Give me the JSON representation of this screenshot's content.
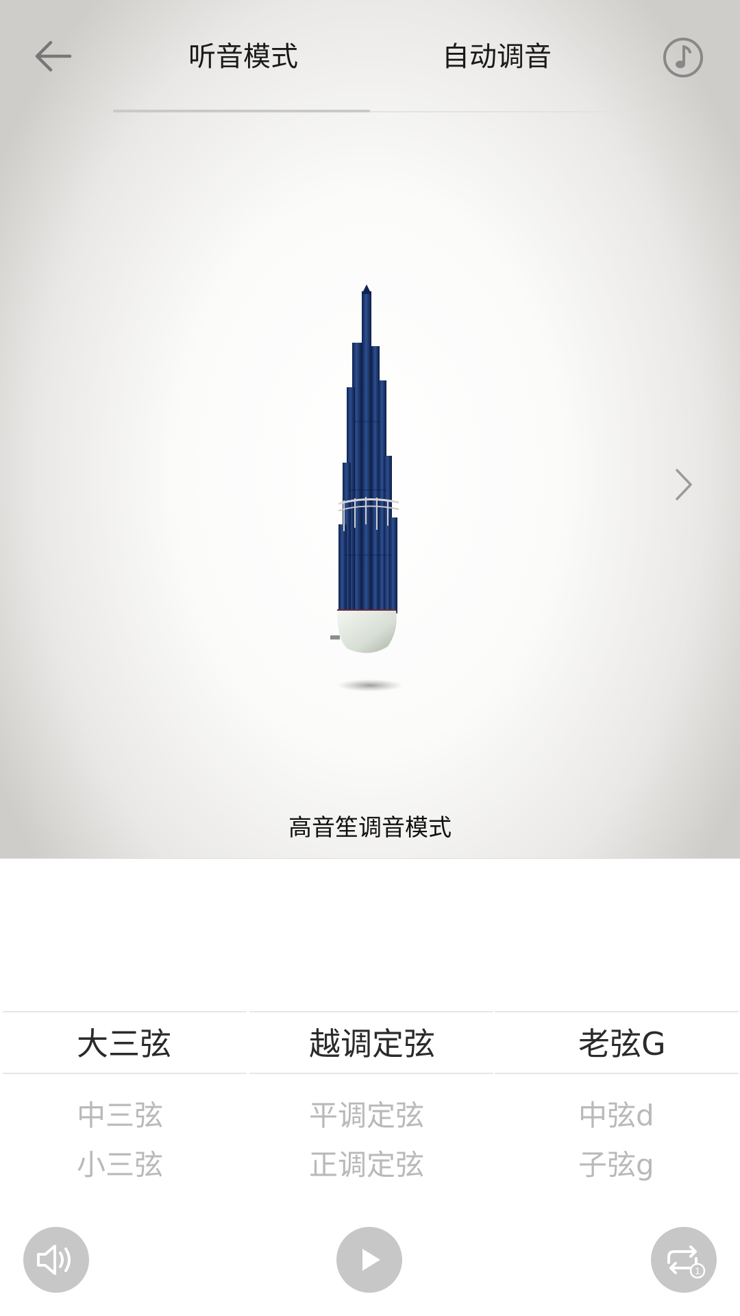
{
  "header": {
    "back_icon": "arrow-left-icon",
    "tabs": [
      {
        "label": "听音模式",
        "active": true
      },
      {
        "label": "自动调音",
        "active": false
      }
    ],
    "settings_icon": "music-note-circle-icon"
  },
  "main": {
    "instrument_icon": "sheng-instrument-image",
    "next_icon": "chevron-right-icon",
    "caption": "高音笙调音模式"
  },
  "picker": {
    "columns": [
      {
        "selected": "大三弦",
        "options": [
          "中三弦",
          "小三弦"
        ]
      },
      {
        "selected": "越调定弦",
        "options": [
          "平调定弦",
          "正调定弦"
        ]
      },
      {
        "selected": "老弦G",
        "options": [
          "中弦d",
          "子弦g"
        ]
      }
    ]
  },
  "controls": {
    "volume_icon": "speaker-icon",
    "play_icon": "play-icon",
    "loop_icon": "repeat-one-icon",
    "loop_badge": "1"
  },
  "colors": {
    "control_bg": "#c7c7c7",
    "selected_text": "#2a2a2a",
    "unselected_text": "#b9b9b9",
    "instrument_blue": "#1f3a72"
  }
}
